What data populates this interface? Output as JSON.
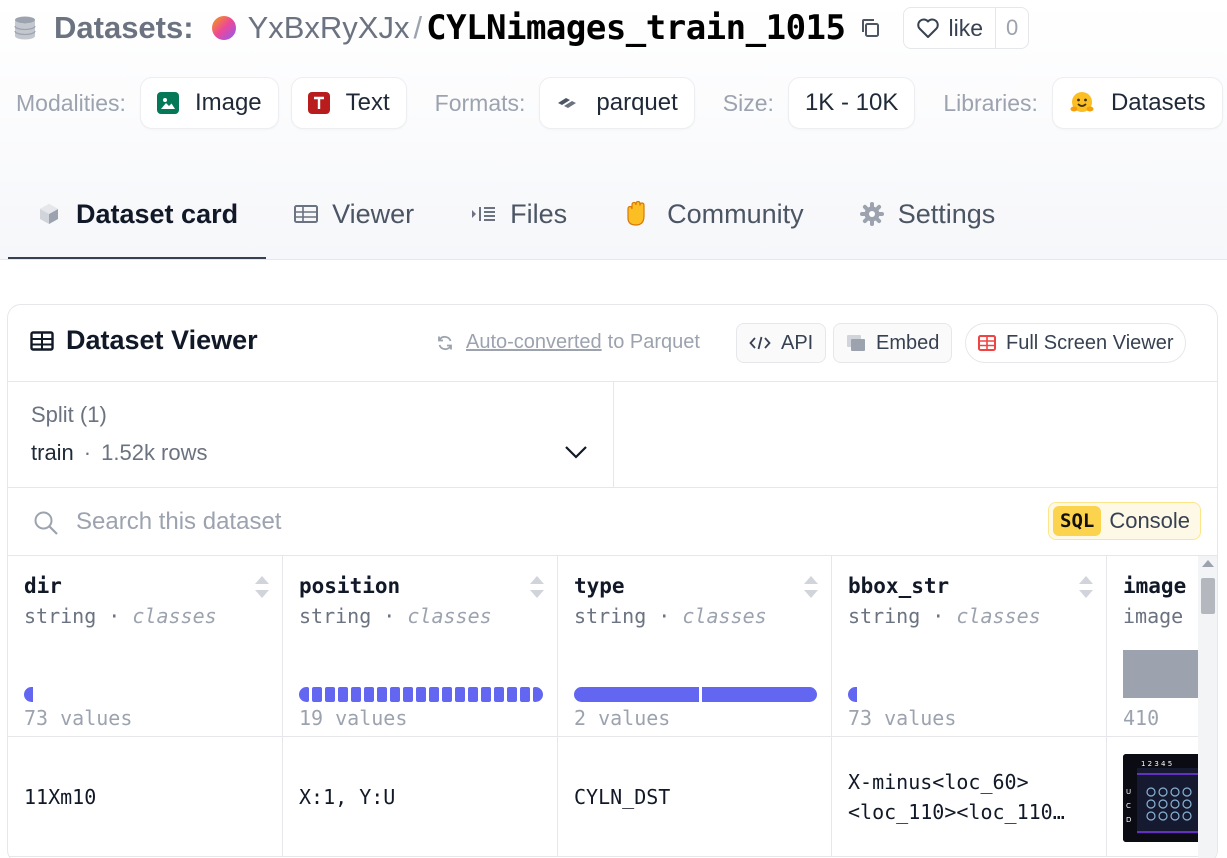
{
  "header": {
    "datasets_label": "Datasets:",
    "owner": "YxBxRyXJx",
    "slash": "/",
    "repo": "CYLNimages_train_1015",
    "like_label": "like",
    "like_count": "0"
  },
  "meta": {
    "modalities_label": "Modalities:",
    "modalities": [
      "Image",
      "Text"
    ],
    "formats_label": "Formats:",
    "format": "parquet",
    "size_label": "Size:",
    "size": "1K - 10K",
    "libraries_label": "Libraries:",
    "library": "Datasets"
  },
  "tabs": [
    {
      "label": "Dataset card",
      "icon": "cube-icon",
      "active": true
    },
    {
      "label": "Viewer",
      "icon": "table-icon",
      "active": false
    },
    {
      "label": "Files",
      "icon": "files-icon",
      "active": false
    },
    {
      "label": "Community",
      "icon": "wave-hand-icon",
      "active": false
    },
    {
      "label": "Settings",
      "icon": "gear-icon",
      "active": false
    }
  ],
  "viewer": {
    "title": "Dataset Viewer",
    "auto_link": "Auto-converted",
    "auto_rest": "to Parquet",
    "api_label": "API",
    "embed_label": "Embed",
    "full_label": "Full Screen Viewer",
    "split_label": "Split (1)",
    "split_name": "train",
    "split_dot": "·",
    "split_rows": "1.52k rows",
    "search_placeholder": "Search this dataset",
    "sql_tag": "SQL",
    "sql_label": "Console"
  },
  "table": {
    "columns": [
      {
        "name": "dir",
        "type": "string",
        "sub": "classes",
        "count": "73 values"
      },
      {
        "name": "position",
        "type": "string",
        "sub": "classes",
        "count": "19 values"
      },
      {
        "name": "type",
        "type": "string",
        "sub": "classes",
        "count": "2 values"
      },
      {
        "name": "bbox_str",
        "type": "string",
        "sub": "classes",
        "count": "73 values"
      },
      {
        "name": "image",
        "type": "image",
        "sub": "",
        "count": "410"
      }
    ],
    "type_sep": "·",
    "row": {
      "dir": "11Xm10",
      "position": "X:1, Y:U",
      "type": "CYLN_DST",
      "bbox_line1": "X-minus<loc_60>",
      "bbox_line2": "<loc_110><loc_110…"
    },
    "thumb_labels": {
      "top": "1 2 3 4 5",
      "left": "U C D"
    }
  },
  "colors": {
    "accent": "#6366f1",
    "sql_bg": "#fcd34d",
    "full_icon": "#ef4444"
  }
}
